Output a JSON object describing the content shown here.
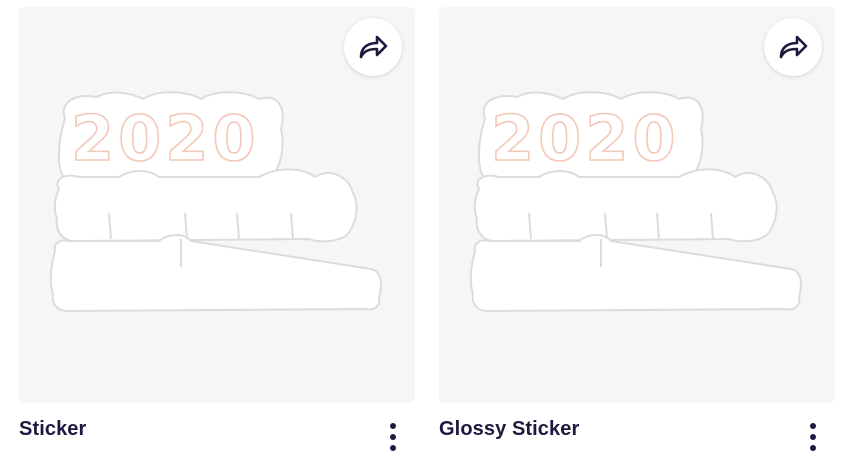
{
  "colors": {
    "tile_bg": "#f6f6f6",
    "text_dark": "#1d1a40",
    "sticker_outline": "#dcdcdc",
    "sticker_text": "#f3c8b8"
  },
  "cards": [
    {
      "title": "Sticker",
      "art_text": "2020",
      "share_icon": "share-arrow-icon",
      "more_icon": "more-vertical-icon"
    },
    {
      "title": "Glossy Sticker",
      "art_text": "2020",
      "share_icon": "share-arrow-icon",
      "more_icon": "more-vertical-icon"
    }
  ]
}
